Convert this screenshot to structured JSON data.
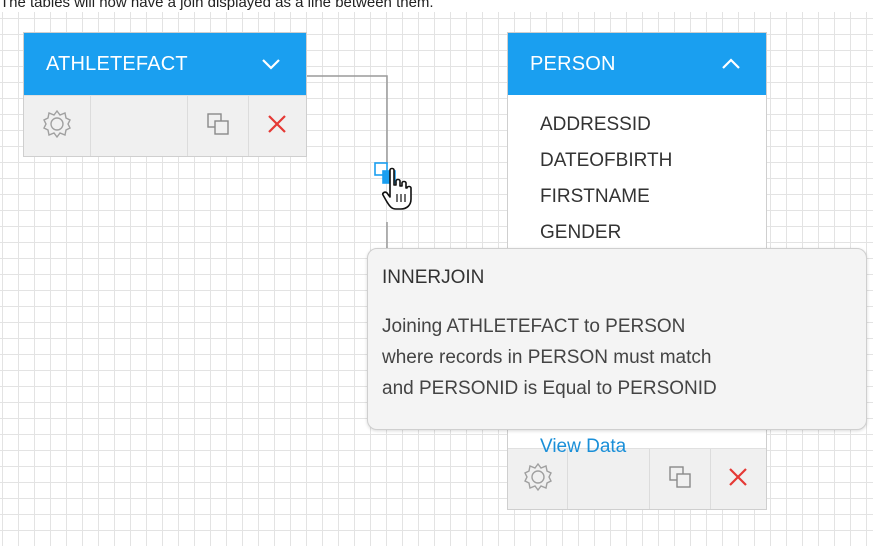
{
  "caption": "The tables will now have a join displayed as a line between them.",
  "tables": {
    "athlete": {
      "name": "ATHLETEFACT"
    },
    "person": {
      "name": "PERSON",
      "fields": [
        "ADDRESSID",
        "DATEOFBIRTH",
        "FIRSTNAME",
        "GENDER"
      ],
      "view_data_label": "View Data"
    }
  },
  "tooltip": {
    "title": "INNERJOIN",
    "lines": [
      "Joining ATHLETEFACT to PERSON",
      "where records in PERSON must match",
      "and PERSONID is Equal to PERSONID"
    ]
  },
  "colors": {
    "header": "#1a9ff0",
    "delete": "#e53935",
    "link": "#1a8fd8"
  },
  "icons": {
    "settings": "gear-icon",
    "duplicate": "copy-icon",
    "delete": "close-icon",
    "expand": "chevron-down-icon",
    "collapse": "chevron-up-icon",
    "join": "join-handle-icon",
    "pointer": "hand-cursor-icon"
  }
}
